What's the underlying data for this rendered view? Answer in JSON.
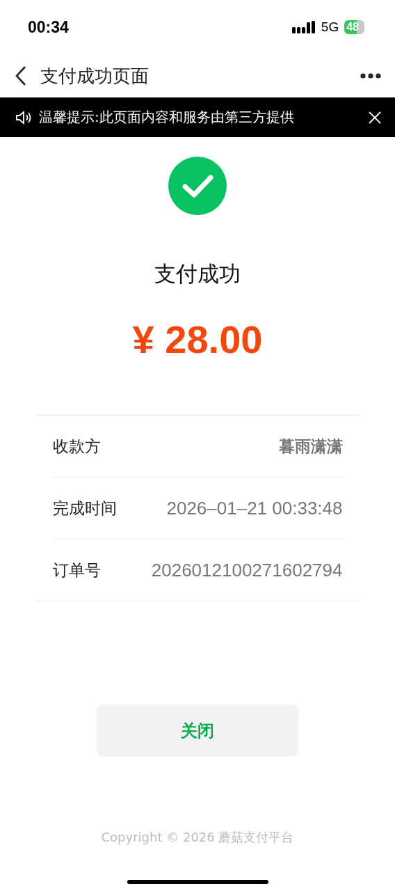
{
  "status_bar": {
    "time": "00:34",
    "network": "5G",
    "battery": "48"
  },
  "nav_bar": {
    "title": "支付成功页面"
  },
  "notice": {
    "text": "温馨提示:此页面内容和服务由第三方提供"
  },
  "result": {
    "title": "支付成功",
    "amount": "¥ 28.00"
  },
  "details": [
    {
      "label": "收款方",
      "value": "暮雨潇潇",
      "kind": "name"
    },
    {
      "label": "完成时间",
      "value": "2026–01–21 00:33:48",
      "kind": "plain"
    },
    {
      "label": "订单号",
      "value": "2026012100271602794",
      "kind": "plain"
    }
  ],
  "close_button": "关闭",
  "footer": "Copyright © 2026 蘑菇支付平台"
}
